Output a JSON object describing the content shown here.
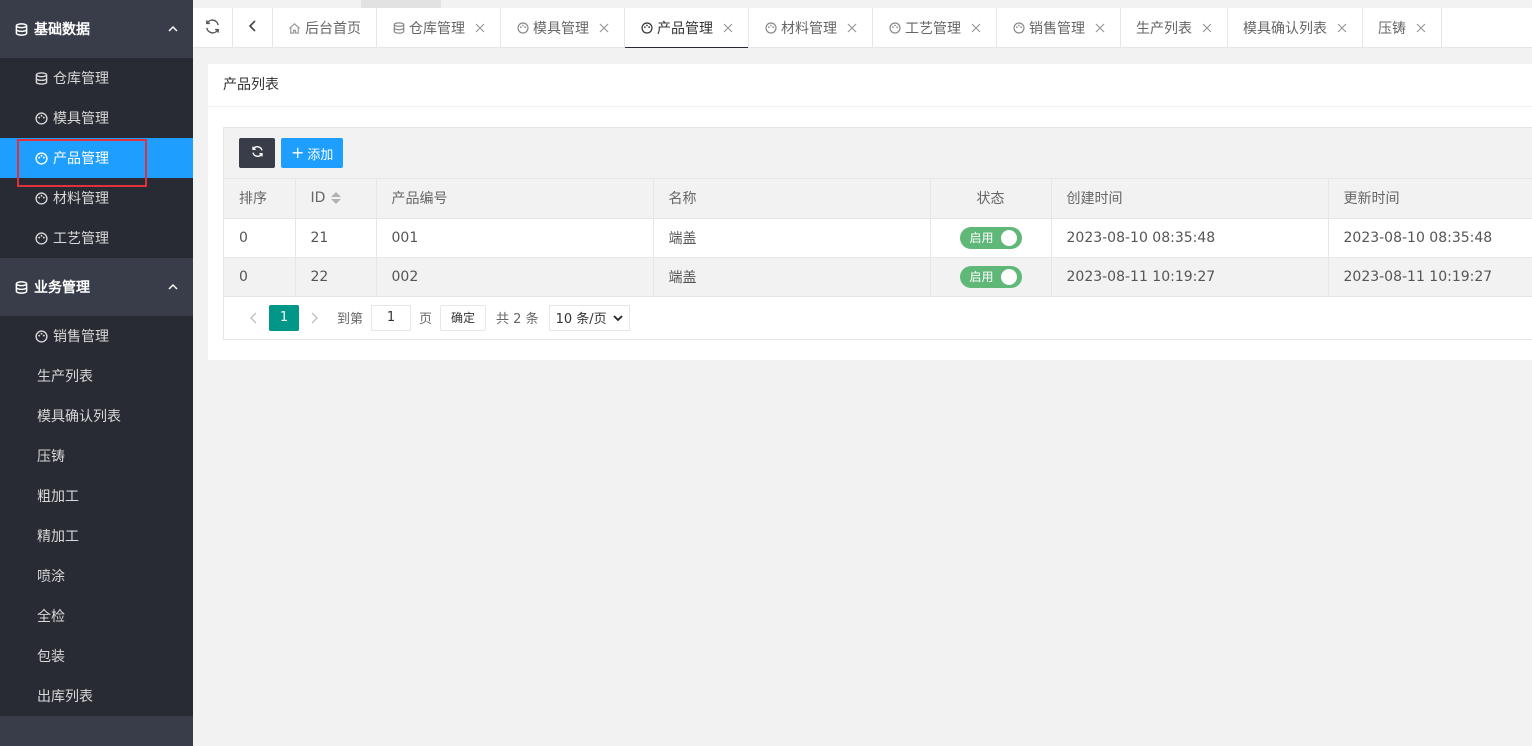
{
  "sidebar": {
    "groups": [
      {
        "title": "基础数据",
        "items": [
          {
            "label": "仓库管理",
            "icon": "database-icon"
          },
          {
            "label": "模具管理",
            "icon": "palette-icon"
          },
          {
            "label": "产品管理",
            "icon": "palette-icon",
            "active": true
          },
          {
            "label": "材料管理",
            "icon": "palette-icon"
          },
          {
            "label": "工艺管理",
            "icon": "palette-icon"
          }
        ]
      },
      {
        "title": "业务管理",
        "items": [
          {
            "label": "销售管理",
            "icon": "palette-icon"
          },
          {
            "label": "生产列表"
          },
          {
            "label": "模具确认列表"
          },
          {
            "label": "压铸"
          },
          {
            "label": "粗加工"
          },
          {
            "label": "精加工"
          },
          {
            "label": "喷涂"
          },
          {
            "label": "全检"
          },
          {
            "label": "包装"
          },
          {
            "label": "出库列表"
          }
        ]
      }
    ]
  },
  "tabs": [
    {
      "label": "后台首页",
      "icon": "home-icon"
    },
    {
      "label": "仓库管理",
      "icon": "database-icon"
    },
    {
      "label": "模具管理",
      "icon": "palette-icon"
    },
    {
      "label": "产品管理",
      "icon": "palette-icon",
      "active": true
    },
    {
      "label": "材料管理",
      "icon": "palette-icon"
    },
    {
      "label": "工艺管理",
      "icon": "palette-icon"
    },
    {
      "label": "销售管理",
      "icon": "palette-icon"
    },
    {
      "label": "生产列表"
    },
    {
      "label": "模具确认列表"
    },
    {
      "label": "压铸"
    }
  ],
  "card": {
    "title": "产品列表",
    "add_label": "添加"
  },
  "table": {
    "headers": [
      "排序",
      "ID",
      "产品编号",
      "名称",
      "状态",
      "创建时间",
      "更新时间"
    ],
    "rows": [
      {
        "sort": "0",
        "id": "21",
        "code": "001",
        "name": "端盖",
        "status": "启用",
        "created": "2023-08-10 08:35:48",
        "updated": "2023-08-10 08:35:48"
      },
      {
        "sort": "0",
        "id": "22",
        "code": "002",
        "name": "端盖",
        "status": "启用",
        "created": "2023-08-11 10:19:27",
        "updated": "2023-08-11 10:19:27"
      }
    ]
  },
  "pager": {
    "current": "1",
    "goto_label": "到第",
    "page_input": "1",
    "page_label": "页",
    "confirm_label": "确定",
    "total_label": "共 2 条",
    "page_size": "10 条/页"
  },
  "colors": {
    "sidebar_bg": "#393d49",
    "sidebar_sub_bg": "#282b33",
    "active_blue": "#1e9fff",
    "switch_green": "#5fb878",
    "pager_teal": "#009688",
    "highlight_red": "#e2313b"
  }
}
